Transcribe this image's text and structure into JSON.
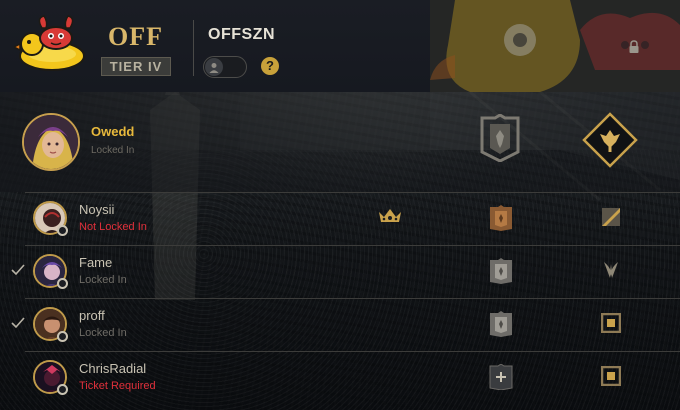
{
  "team": {
    "tag": "OFF",
    "tier": "TIER IV",
    "name": "OFFSZN",
    "help_label": "?",
    "logo_icon": "rubber-duck-crab-logo",
    "colors": {
      "gold": "#d9b76a",
      "duck_yellow": "#f3c61c",
      "crab_red": "#d83a36"
    }
  },
  "captain": {
    "name": "Owedd",
    "status": "Locked In",
    "rank_icon": "rank-shield-icon",
    "position_icon": "support-position-icon"
  },
  "members": [
    {
      "name": "Noysii",
      "status": "Not Locked In",
      "status_color": "#e0303b",
      "checked": false,
      "crown": true,
      "rank_icon": "rank-bronze-icon",
      "position_icon": "bottom-lane-icon"
    },
    {
      "name": "Fame",
      "status": "Locked In",
      "status_color": "#6f6c66",
      "checked": true,
      "crown": false,
      "rank_icon": "rank-silver-icon",
      "position_icon": "jungle-icon"
    },
    {
      "name": "proff",
      "status": "Locked In",
      "status_color": "#6f6c66",
      "checked": true,
      "crown": false,
      "rank_icon": "rank-silver-icon",
      "position_icon": "middle-lane-icon"
    },
    {
      "name": "ChrisRadial",
      "status": "Ticket Required",
      "status_color": "#e0303b",
      "checked": false,
      "crown": false,
      "rank_icon": "ticket-plus-icon",
      "position_icon": "middle-lane-icon"
    }
  ]
}
